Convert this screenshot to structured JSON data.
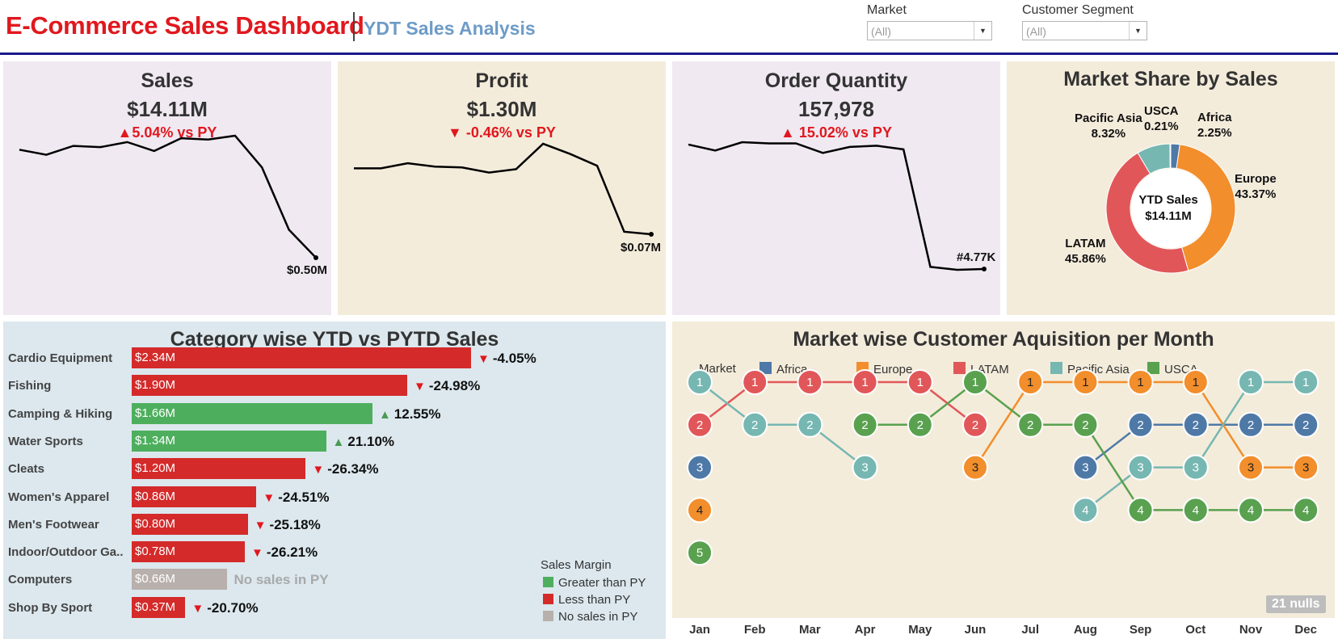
{
  "header": {
    "title": "E-Commerce Sales Dashboard",
    "subtitle": "YDT Sales Analysis",
    "filters": [
      {
        "label": "Market",
        "value": "(All)"
      },
      {
        "label": "Customer Segment",
        "value": "(All)"
      }
    ]
  },
  "colors": {
    "red": "#e0181e",
    "green": "#4daf5e",
    "bar_red": "#d42a2a",
    "bar_grey": "#b8b0ac",
    "lavender": "#f0e9f2",
    "beige": "#f4ecdb",
    "lightblue": "#dce8ee",
    "africa": "#4e79a7",
    "europe": "#f28e2b",
    "latam": "#e15759",
    "pacific_asia": "#76b7b2",
    "usca": "#59a14f"
  },
  "kpis": [
    {
      "title": "Sales",
      "value": "$14.11M",
      "change": "▲5.04% vs PY",
      "end_label": "$0.50M"
    },
    {
      "title": "Profit",
      "value": "$1.30M",
      "change": "▼ -0.46% vs PY",
      "end_label": "$0.07M"
    },
    {
      "title": "Order Quantity",
      "value": "157,978",
      "change": "▲ 15.02% vs PY",
      "end_label": "#4.77K"
    }
  ],
  "market_share": {
    "title": "Market Share by Sales",
    "center_title": "YTD Sales",
    "center_value": "$14.11M",
    "slices": [
      {
        "name": "USCA",
        "pct": "0.21%",
        "value": 0.21
      },
      {
        "name": "Africa",
        "pct": "2.25%",
        "value": 2.25
      },
      {
        "name": "Europe",
        "pct": "43.37%",
        "value": 43.37
      },
      {
        "name": "LATAM",
        "pct": "45.86%",
        "value": 45.86
      },
      {
        "name": "Pacific Asia",
        "pct": "8.32%",
        "value": 8.32
      }
    ]
  },
  "category": {
    "title": "Category wise YTD vs PYTD Sales",
    "legend_title": "Sales Margin",
    "legend": [
      "Greater than PY",
      "Less than PY",
      "No sales in PY"
    ],
    "rows": [
      {
        "name": "Cardio Equipment",
        "label": "$2.34M",
        "value": 2.34,
        "status": "down",
        "change": "-4.05%"
      },
      {
        "name": "Fishing",
        "label": "$1.90M",
        "value": 1.9,
        "status": "down",
        "change": "-24.98%"
      },
      {
        "name": "Camping & Hiking",
        "label": "$1.66M",
        "value": 1.66,
        "status": "up",
        "change": "12.55%"
      },
      {
        "name": "Water Sports",
        "label": "$1.34M",
        "value": 1.34,
        "status": "up",
        "change": "21.10%"
      },
      {
        "name": "Cleats",
        "label": "$1.20M",
        "value": 1.2,
        "status": "down",
        "change": "-26.34%"
      },
      {
        "name": "Women's Apparel",
        "label": "$0.86M",
        "value": 0.86,
        "status": "down",
        "change": "-24.51%"
      },
      {
        "name": "Men's Footwear",
        "label": "$0.80M",
        "value": 0.8,
        "status": "down",
        "change": "-25.18%"
      },
      {
        "name": "Indoor/Outdoor Ga..",
        "label": "$0.78M",
        "value": 0.78,
        "status": "down",
        "change": "-26.21%"
      },
      {
        "name": "Computers",
        "label": "$0.66M",
        "value": 0.66,
        "status": "none",
        "change": "No sales in PY"
      },
      {
        "name": "Shop By Sport",
        "label": "$0.37M",
        "value": 0.37,
        "status": "down",
        "change": "-20.70%"
      }
    ]
  },
  "acquisition": {
    "title": "Market wise Customer Aquisition per Month",
    "legend_label": "Market",
    "legend": [
      "Africa",
      "Europe",
      "LATAM",
      "Pacific Asia",
      "USCA"
    ],
    "nulls_badge": "21 nulls"
  },
  "chart_data": [
    {
      "type": "line",
      "title": "Sales",
      "x": [
        1,
        2,
        3,
        4,
        5,
        6,
        7,
        8,
        9,
        10,
        11,
        12
      ],
      "series": [
        {
          "values": [
            1.35,
            1.31,
            1.38,
            1.37,
            1.41,
            1.34,
            1.44,
            1.43,
            1.46,
            1.21,
            0.72,
            0.5
          ]
        }
      ]
    },
    {
      "type": "line",
      "title": "Profit",
      "x": [
        1,
        2,
        3,
        4,
        5,
        6,
        7,
        8,
        9,
        10,
        11,
        12
      ],
      "series": [
        {
          "values": [
            0.148,
            0.148,
            0.154,
            0.15,
            0.149,
            0.143,
            0.147,
            0.177,
            0.165,
            0.151,
            0.073,
            0.07
          ]
        }
      ]
    },
    {
      "type": "line",
      "title": "Order Quantity",
      "x": [
        1,
        2,
        3,
        4,
        5,
        6,
        7,
        8,
        9,
        10,
        11,
        12
      ],
      "series": [
        {
          "values": [
            15.2,
            14.7,
            15.4,
            15.3,
            15.3,
            14.5,
            15.0,
            15.1,
            14.8,
            4.95,
            4.7,
            4.77
          ]
        }
      ]
    },
    {
      "type": "pie",
      "title": "Market Share by Sales",
      "categories": [
        "USCA",
        "Africa",
        "Europe",
        "LATAM",
        "Pacific Asia"
      ],
      "values": [
        0.21,
        2.25,
        43.37,
        45.86,
        8.32
      ]
    },
    {
      "type": "bar",
      "title": "Category wise YTD vs PYTD Sales",
      "categories": [
        "Cardio Equipment",
        "Fishing",
        "Camping & Hiking",
        "Water Sports",
        "Cleats",
        "Women's Apparel",
        "Men's Footwear",
        "Indoor/Outdoor Ga..",
        "Computers",
        "Shop By Sport"
      ],
      "values": [
        2.34,
        1.9,
        1.66,
        1.34,
        1.2,
        0.86,
        0.8,
        0.78,
        0.66,
        0.37
      ],
      "change_pct": [
        -4.05,
        -24.98,
        12.55,
        21.1,
        -26.34,
        -24.51,
        -25.18,
        -26.21,
        null,
        -20.7
      ]
    },
    {
      "type": "line",
      "title": "Market wise Customer Aquisition per Month",
      "categories": [
        "Jan",
        "Feb",
        "Mar",
        "Apr",
        "May",
        "Jun",
        "Jul",
        "Aug",
        "Sep",
        "Oct",
        "Nov",
        "Dec"
      ],
      "series": [
        {
          "name": "Africa",
          "values": [
            3,
            null,
            null,
            null,
            null,
            null,
            null,
            3,
            2,
            2,
            2,
            2
          ]
        },
        {
          "name": "Europe",
          "values": [
            4,
            null,
            null,
            null,
            null,
            3,
            1,
            1,
            1,
            1,
            3,
            3
          ]
        },
        {
          "name": "LATAM",
          "values": [
            2,
            1,
            1,
            1,
            1,
            2,
            null,
            null,
            null,
            null,
            null,
            null
          ]
        },
        {
          "name": "Pacific Asia",
          "values": [
            1,
            2,
            2,
            3,
            null,
            null,
            null,
            4,
            3,
            3,
            1,
            1
          ]
        },
        {
          "name": "USCA",
          "values": [
            5,
            null,
            null,
            2,
            2,
            1,
            2,
            2,
            4,
            4,
            4,
            4
          ]
        }
      ]
    }
  ]
}
